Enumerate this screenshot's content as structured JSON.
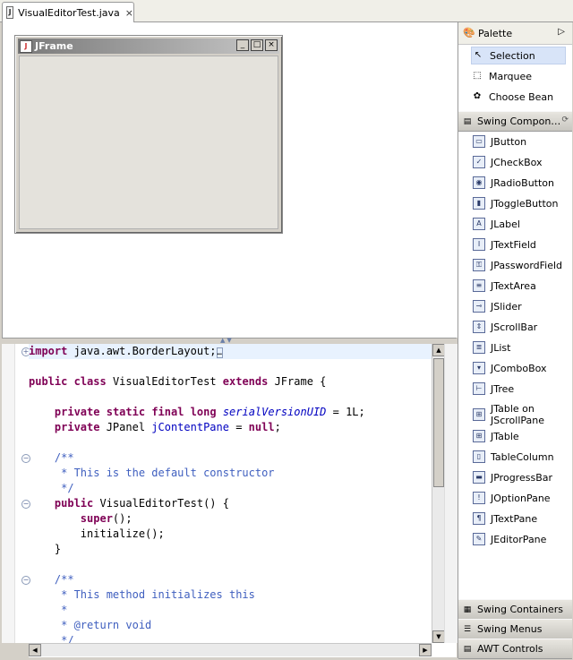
{
  "editor_tab": {
    "label": "VisualEditorTest.java",
    "close": "×"
  },
  "jframe": {
    "title": "JFrame",
    "buttons": [
      "_",
      "□",
      "×"
    ]
  },
  "code_lines": [
    [
      {
        "t": "import",
        "c": "kw"
      },
      {
        "t": " java.awt.BorderLayout;"
      },
      {
        "t": "…",
        "c": "box"
      }
    ],
    [],
    [
      {
        "t": "public",
        "c": "kw"
      },
      {
        "t": " "
      },
      {
        "t": "class",
        "c": "kw"
      },
      {
        "t": " VisualEditorTest "
      },
      {
        "t": "extends",
        "c": "kw"
      },
      {
        "t": " JFrame {"
      }
    ],
    [],
    [
      {
        "t": "    "
      },
      {
        "t": "private",
        "c": "kw"
      },
      {
        "t": " "
      },
      {
        "t": "static",
        "c": "kw"
      },
      {
        "t": " "
      },
      {
        "t": "final",
        "c": "kw"
      },
      {
        "t": " "
      },
      {
        "t": "long",
        "c": "kw"
      },
      {
        "t": " "
      },
      {
        "t": "serialVersionUID",
        "c": "sfld"
      },
      {
        "t": " = 1L;"
      }
    ],
    [
      {
        "t": "    "
      },
      {
        "t": "private",
        "c": "kw"
      },
      {
        "t": " JPanel "
      },
      {
        "t": "jContentPane",
        "c": "fld"
      },
      {
        "t": " = "
      },
      {
        "t": "null",
        "c": "kw"
      },
      {
        "t": ";"
      }
    ],
    [],
    [
      {
        "t": "    /**",
        "c": "cm"
      }
    ],
    [
      {
        "t": "     * This is the default constructor",
        "c": "cm"
      }
    ],
    [
      {
        "t": "     */",
        "c": "cm"
      }
    ],
    [
      {
        "t": "    "
      },
      {
        "t": "public",
        "c": "kw"
      },
      {
        "t": " VisualEditorTest() {"
      }
    ],
    [
      {
        "t": "        "
      },
      {
        "t": "super",
        "c": "kw"
      },
      {
        "t": "();"
      }
    ],
    [
      {
        "t": "        initialize();"
      }
    ],
    [
      {
        "t": "    }"
      }
    ],
    [],
    [
      {
        "t": "    /**",
        "c": "cm"
      }
    ],
    [
      {
        "t": "     * This method initializes this",
        "c": "cm"
      }
    ],
    [
      {
        "t": "     *",
        "c": "cm"
      }
    ],
    [
      {
        "t": "     * @return void",
        "c": "cm"
      }
    ],
    [
      {
        "t": "     */",
        "c": "cm"
      }
    ]
  ],
  "palette": {
    "title": "Palette",
    "tools": [
      {
        "label": "Selection",
        "icon": "arrow-cursor-icon",
        "glyph": "↖"
      },
      {
        "label": "Marquee",
        "icon": "marquee-icon",
        "glyph": "⬚"
      },
      {
        "label": "Choose Bean",
        "icon": "bean-icon",
        "glyph": "✿"
      }
    ],
    "drawer_swing_components": "Swing Compon…",
    "components": [
      {
        "label": "JButton",
        "icon": "button-icon",
        "glyph": "▭"
      },
      {
        "label": "JCheckBox",
        "icon": "checkbox-icon",
        "glyph": "✓"
      },
      {
        "label": "JRadioButton",
        "icon": "radio-icon",
        "glyph": "◉"
      },
      {
        "label": "JToggleButton",
        "icon": "toggle-icon",
        "glyph": "▮"
      },
      {
        "label": "JLabel",
        "icon": "label-icon",
        "glyph": "A"
      },
      {
        "label": "JTextField",
        "icon": "textfield-icon",
        "glyph": "I"
      },
      {
        "label": "JPasswordField",
        "icon": "key-icon",
        "glyph": "⚿"
      },
      {
        "label": "JTextArea",
        "icon": "textarea-icon",
        "glyph": "≡"
      },
      {
        "label": "JSlider",
        "icon": "slider-icon",
        "glyph": "⊸"
      },
      {
        "label": "JScrollBar",
        "icon": "scrollbar-icon",
        "glyph": "⇕"
      },
      {
        "label": "JList",
        "icon": "list-icon",
        "glyph": "≣"
      },
      {
        "label": "JComboBox",
        "icon": "combobox-icon",
        "glyph": "▾"
      },
      {
        "label": "JTree",
        "icon": "tree-icon",
        "glyph": "⊢"
      },
      {
        "label": "JTable on\nJScrollPane",
        "icon": "table-scroll-icon",
        "glyph": "⊞"
      },
      {
        "label": "JTable",
        "icon": "table-icon",
        "glyph": "⊞"
      },
      {
        "label": "TableColumn",
        "icon": "table-column-icon",
        "glyph": "▯"
      },
      {
        "label": "JProgressBar",
        "icon": "progressbar-icon",
        "glyph": "▬"
      },
      {
        "label": "JOptionPane",
        "icon": "optionpane-icon",
        "glyph": "!"
      },
      {
        "label": "JTextPane",
        "icon": "textpane-icon",
        "glyph": "¶"
      },
      {
        "label": "JEditorPane",
        "icon": "editorpane-icon",
        "glyph": "✎"
      }
    ],
    "drawers_bottom": [
      {
        "label": "Swing Containers",
        "icon": "swing-containers-icon",
        "glyph": "▦"
      },
      {
        "label": "Swing Menus",
        "icon": "swing-menus-icon",
        "glyph": "☰"
      },
      {
        "label": "AWT Controls",
        "icon": "awt-controls-icon",
        "glyph": "▤"
      }
    ]
  }
}
